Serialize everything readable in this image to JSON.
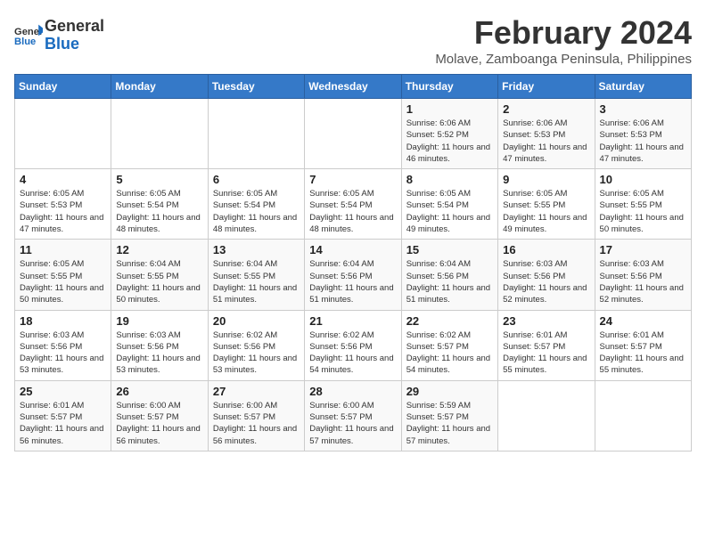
{
  "logo": {
    "line1": "General",
    "line2": "Blue"
  },
  "title": "February 2024",
  "location": "Molave, Zamboanga Peninsula, Philippines",
  "days_of_week": [
    "Sunday",
    "Monday",
    "Tuesday",
    "Wednesday",
    "Thursday",
    "Friday",
    "Saturday"
  ],
  "weeks": [
    [
      {
        "num": "",
        "detail": ""
      },
      {
        "num": "",
        "detail": ""
      },
      {
        "num": "",
        "detail": ""
      },
      {
        "num": "",
        "detail": ""
      },
      {
        "num": "1",
        "detail": "Sunrise: 6:06 AM\nSunset: 5:52 PM\nDaylight: 11 hours\nand 46 minutes."
      },
      {
        "num": "2",
        "detail": "Sunrise: 6:06 AM\nSunset: 5:53 PM\nDaylight: 11 hours\nand 47 minutes."
      },
      {
        "num": "3",
        "detail": "Sunrise: 6:06 AM\nSunset: 5:53 PM\nDaylight: 11 hours\nand 47 minutes."
      }
    ],
    [
      {
        "num": "4",
        "detail": "Sunrise: 6:05 AM\nSunset: 5:53 PM\nDaylight: 11 hours\nand 47 minutes."
      },
      {
        "num": "5",
        "detail": "Sunrise: 6:05 AM\nSunset: 5:54 PM\nDaylight: 11 hours\nand 48 minutes."
      },
      {
        "num": "6",
        "detail": "Sunrise: 6:05 AM\nSunset: 5:54 PM\nDaylight: 11 hours\nand 48 minutes."
      },
      {
        "num": "7",
        "detail": "Sunrise: 6:05 AM\nSunset: 5:54 PM\nDaylight: 11 hours\nand 48 minutes."
      },
      {
        "num": "8",
        "detail": "Sunrise: 6:05 AM\nSunset: 5:54 PM\nDaylight: 11 hours\nand 49 minutes."
      },
      {
        "num": "9",
        "detail": "Sunrise: 6:05 AM\nSunset: 5:55 PM\nDaylight: 11 hours\nand 49 minutes."
      },
      {
        "num": "10",
        "detail": "Sunrise: 6:05 AM\nSunset: 5:55 PM\nDaylight: 11 hours\nand 50 minutes."
      }
    ],
    [
      {
        "num": "11",
        "detail": "Sunrise: 6:05 AM\nSunset: 5:55 PM\nDaylight: 11 hours\nand 50 minutes."
      },
      {
        "num": "12",
        "detail": "Sunrise: 6:04 AM\nSunset: 5:55 PM\nDaylight: 11 hours\nand 50 minutes."
      },
      {
        "num": "13",
        "detail": "Sunrise: 6:04 AM\nSunset: 5:55 PM\nDaylight: 11 hours\nand 51 minutes."
      },
      {
        "num": "14",
        "detail": "Sunrise: 6:04 AM\nSunset: 5:56 PM\nDaylight: 11 hours\nand 51 minutes."
      },
      {
        "num": "15",
        "detail": "Sunrise: 6:04 AM\nSunset: 5:56 PM\nDaylight: 11 hours\nand 51 minutes."
      },
      {
        "num": "16",
        "detail": "Sunrise: 6:03 AM\nSunset: 5:56 PM\nDaylight: 11 hours\nand 52 minutes."
      },
      {
        "num": "17",
        "detail": "Sunrise: 6:03 AM\nSunset: 5:56 PM\nDaylight: 11 hours\nand 52 minutes."
      }
    ],
    [
      {
        "num": "18",
        "detail": "Sunrise: 6:03 AM\nSunset: 5:56 PM\nDaylight: 11 hours\nand 53 minutes."
      },
      {
        "num": "19",
        "detail": "Sunrise: 6:03 AM\nSunset: 5:56 PM\nDaylight: 11 hours\nand 53 minutes."
      },
      {
        "num": "20",
        "detail": "Sunrise: 6:02 AM\nSunset: 5:56 PM\nDaylight: 11 hours\nand 53 minutes."
      },
      {
        "num": "21",
        "detail": "Sunrise: 6:02 AM\nSunset: 5:56 PM\nDaylight: 11 hours\nand 54 minutes."
      },
      {
        "num": "22",
        "detail": "Sunrise: 6:02 AM\nSunset: 5:57 PM\nDaylight: 11 hours\nand 54 minutes."
      },
      {
        "num": "23",
        "detail": "Sunrise: 6:01 AM\nSunset: 5:57 PM\nDaylight: 11 hours\nand 55 minutes."
      },
      {
        "num": "24",
        "detail": "Sunrise: 6:01 AM\nSunset: 5:57 PM\nDaylight: 11 hours\nand 55 minutes."
      }
    ],
    [
      {
        "num": "25",
        "detail": "Sunrise: 6:01 AM\nSunset: 5:57 PM\nDaylight: 11 hours\nand 56 minutes."
      },
      {
        "num": "26",
        "detail": "Sunrise: 6:00 AM\nSunset: 5:57 PM\nDaylight: 11 hours\nand 56 minutes."
      },
      {
        "num": "27",
        "detail": "Sunrise: 6:00 AM\nSunset: 5:57 PM\nDaylight: 11 hours\nand 56 minutes."
      },
      {
        "num": "28",
        "detail": "Sunrise: 6:00 AM\nSunset: 5:57 PM\nDaylight: 11 hours\nand 57 minutes."
      },
      {
        "num": "29",
        "detail": "Sunrise: 5:59 AM\nSunset: 5:57 PM\nDaylight: 11 hours\nand 57 minutes."
      },
      {
        "num": "",
        "detail": ""
      },
      {
        "num": "",
        "detail": ""
      }
    ]
  ]
}
